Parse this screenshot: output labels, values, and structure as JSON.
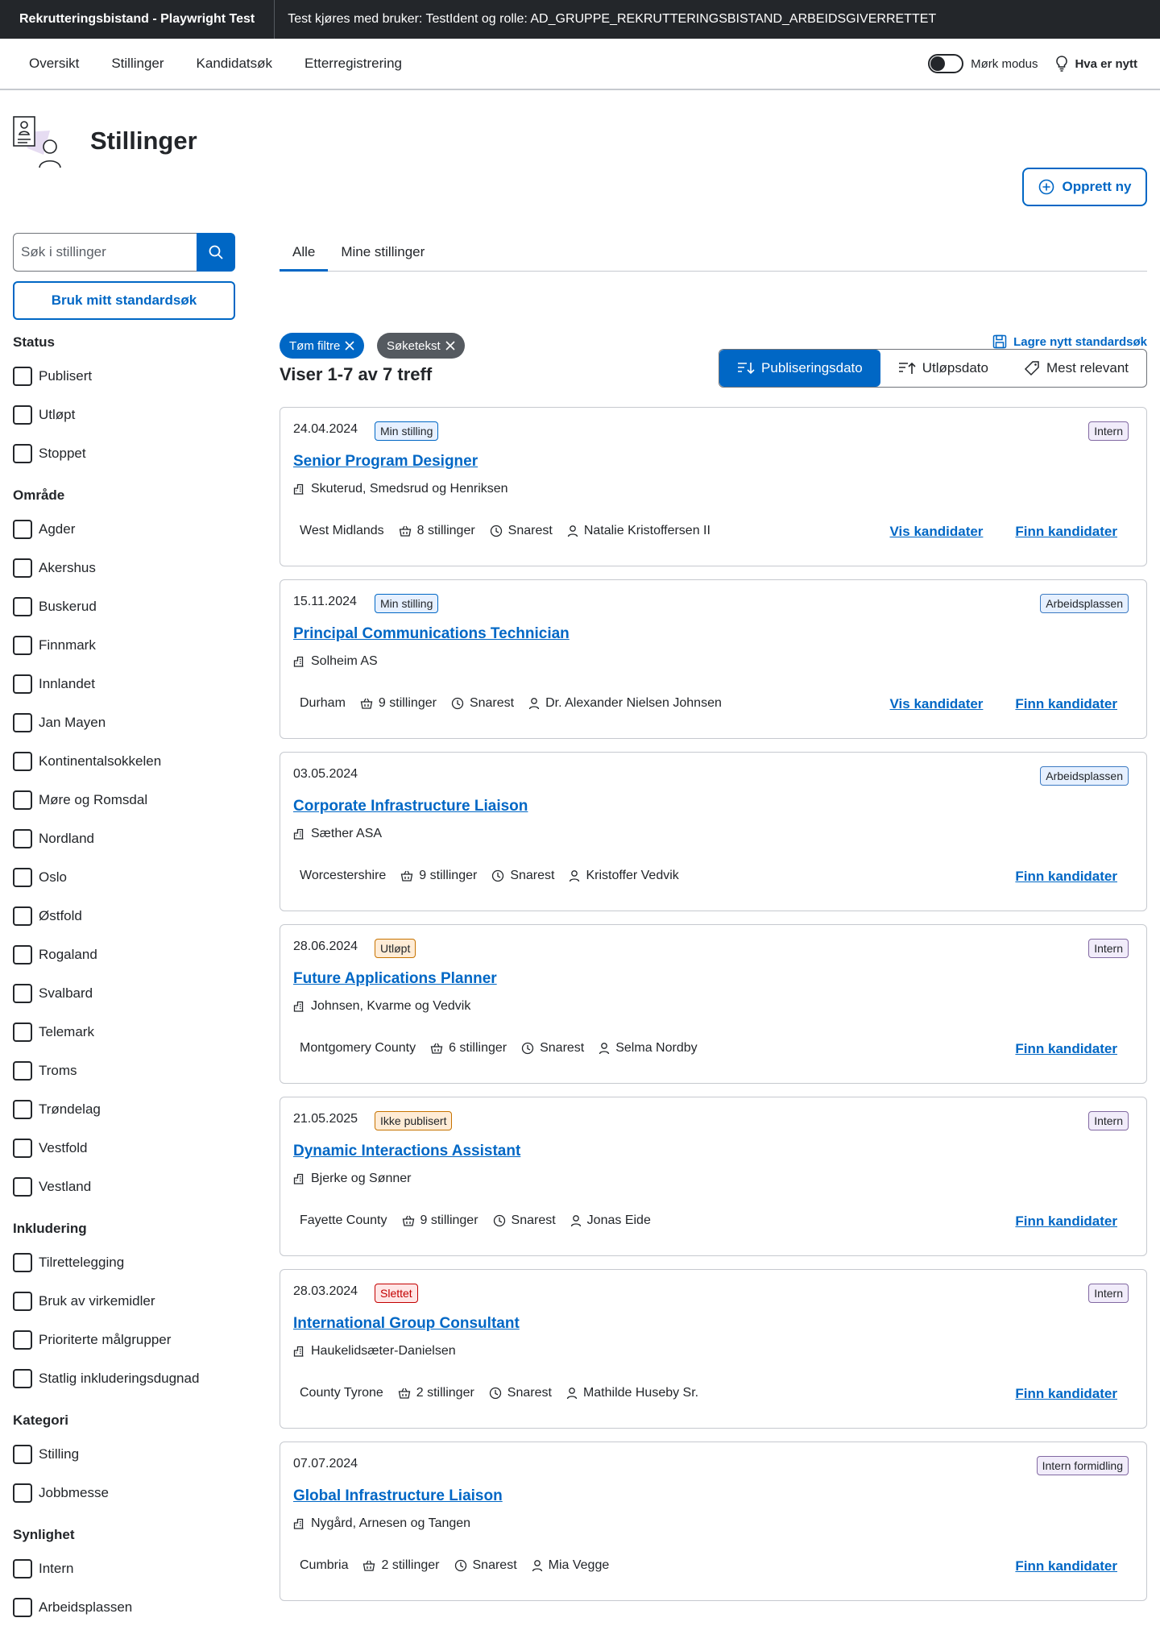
{
  "topbar": {
    "app_title": "Rekrutteringsbistand - Playwright Test",
    "test_info": "Test kjøres med bruker: TestIdent og rolle: AD_GRUPPE_REKRUTTERINGSBISTAND_ARBEIDSGIVERRETTET"
  },
  "nav": {
    "items": [
      "Oversikt",
      "Stillinger",
      "Kandidatsøk",
      "Etterregistrering"
    ],
    "dark_mode_label": "Mørk modus",
    "whats_new_label": "Hva er nytt"
  },
  "header": {
    "title": "Stillinger",
    "create_label": "Opprett ny"
  },
  "sidebar": {
    "search_placeholder": "Søk i stillinger",
    "standard_search_label": "Bruk mitt standardsøk",
    "groups": [
      {
        "title": "Status",
        "options": [
          "Publisert",
          "Utløpt",
          "Stoppet"
        ]
      },
      {
        "title": "Område",
        "options": [
          "Agder",
          "Akershus",
          "Buskerud",
          "Finnmark",
          "Innlandet",
          "Jan Mayen",
          "Kontinentalsokkelen",
          "Møre og Romsdal",
          "Nordland",
          "Oslo",
          "Østfold",
          "Rogaland",
          "Svalbard",
          "Telemark",
          "Troms",
          "Trøndelag",
          "Vestfold",
          "Vestland"
        ]
      },
      {
        "title": "Inkludering",
        "options": [
          "Tilrettelegging",
          "Bruk av virkemidler",
          "Prioriterte målgrupper",
          "Statlig inkluderingsdugnad"
        ]
      },
      {
        "title": "Kategori",
        "options": [
          "Stilling",
          "Jobbmesse"
        ]
      },
      {
        "title": "Synlighet",
        "options": [
          "Intern",
          "Arbeidsplassen"
        ]
      }
    ]
  },
  "main": {
    "tabs": [
      "Alle",
      "Mine stillinger"
    ],
    "chips": [
      "Tøm filtre",
      "Søketekst"
    ],
    "save_search_label": "Lagre nytt standardsøk",
    "result_count": "Viser 1-7 av 7 treff",
    "sort_options": [
      "Publiseringsdato",
      "Utløpsdato",
      "Mest relevant"
    ],
    "colors": {
      "accent": "#0067c5",
      "text": "#23262a",
      "border": "#c6c9cf"
    },
    "cards": [
      {
        "date": "24.04.2024",
        "status": "Min stilling",
        "status_kind": "min",
        "type": "Intern",
        "type_kind": "type",
        "title": "Senior Program Designer",
        "employer": "Skuterud, Smedsrud og Henriksen",
        "location": "West Midlands",
        "positions": "8 stillinger",
        "deadline": "Snarest",
        "owner": "Natalie Kristoffersen II",
        "links": [
          "Vis kandidater",
          "Finn kandidater"
        ]
      },
      {
        "date": "15.11.2024",
        "status": "Min stilling",
        "status_kind": "min",
        "type": "Arbeidsplassen",
        "type_kind": "arb",
        "title": "Principal Communications Technician",
        "employer": "Solheim AS",
        "location": "Durham",
        "positions": "9 stillinger",
        "deadline": "Snarest",
        "owner": "Dr. Alexander Nielsen Johnsen",
        "links": [
          "Vis kandidater",
          "Finn kandidater"
        ]
      },
      {
        "date": "03.05.2024",
        "status": "",
        "status_kind": "",
        "type": "Arbeidsplassen",
        "type_kind": "arb",
        "title": "Corporate Infrastructure Liaison",
        "employer": "Sæther ASA",
        "location": "Worcestershire",
        "positions": "9 stillinger",
        "deadline": "Snarest",
        "owner": "Kristoffer Vedvik",
        "links": [
          "Finn kandidater"
        ]
      },
      {
        "date": "28.06.2024",
        "status": "Utløpt",
        "status_kind": "utl",
        "type": "Intern",
        "type_kind": "type",
        "title": "Future Applications Planner",
        "employer": "Johnsen, Kvarme og Vedvik",
        "location": "Montgomery County",
        "positions": "6 stillinger",
        "deadline": "Snarest",
        "owner": "Selma Nordby",
        "links": [
          "Finn kandidater"
        ]
      },
      {
        "date": "21.05.2025",
        "status": "Ikke publisert",
        "status_kind": "ikke",
        "type": "Intern",
        "type_kind": "type",
        "title": "Dynamic Interactions Assistant",
        "employer": "Bjerke og Sønner",
        "location": "Fayette County",
        "positions": "9 stillinger",
        "deadline": "Snarest",
        "owner": "Jonas Eide",
        "links": [
          "Finn kandidater"
        ]
      },
      {
        "date": "28.03.2024",
        "status": "Slettet",
        "status_kind": "slett",
        "type": "Intern",
        "type_kind": "type",
        "title": "International Group Consultant",
        "employer": "Haukelidsæter-Danielsen",
        "location": "County Tyrone",
        "positions": "2 stillinger",
        "deadline": "Snarest",
        "owner": "Mathilde Huseby Sr.",
        "links": [
          "Finn kandidater"
        ]
      },
      {
        "date": "07.07.2024",
        "status": "",
        "status_kind": "",
        "type": "Intern formidling",
        "type_kind": "type",
        "title": "Global Infrastructure Liaison",
        "employer": "Nygård, Arnesen og Tangen",
        "location": "Cumbria",
        "positions": "2 stillinger",
        "deadline": "Snarest",
        "owner": "Mia Vegge",
        "links": [
          "Finn kandidater"
        ]
      }
    ]
  }
}
